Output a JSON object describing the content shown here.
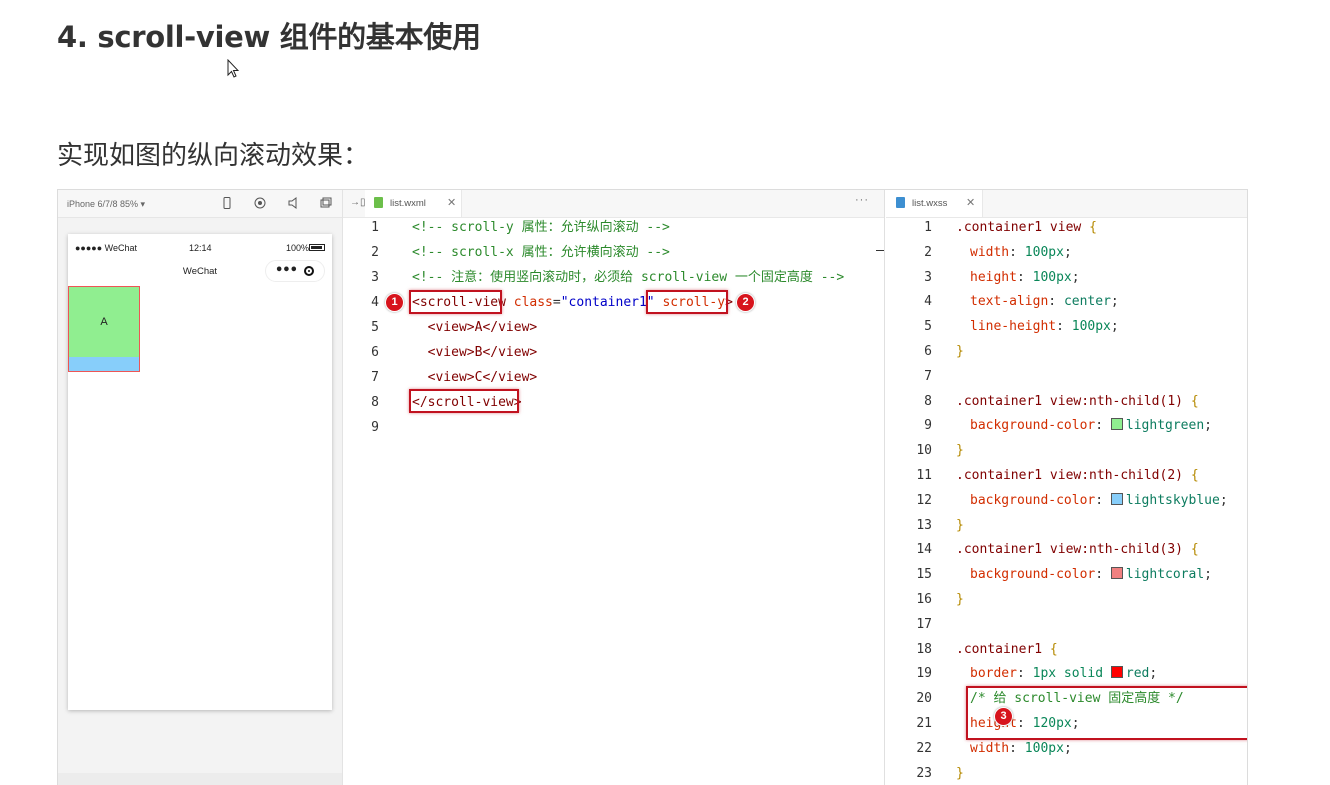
{
  "heading": "4. scroll-view 组件的基本使用",
  "subheading": "实现如图的纵向滚动效果：",
  "simulator": {
    "device": "iPhone 6/7/8 85% ▾",
    "status_left": "●●●●● WeChat",
    "time": "12:14",
    "battery": "100%",
    "nav_title": "WeChat",
    "box_a_label": "A"
  },
  "editor1": {
    "tab_label": "list.wxml",
    "lines": [
      {
        "n": "1",
        "text": "<!-- scroll-y 属性：允许纵向滚动 -->"
      },
      {
        "n": "2",
        "text": "<!-- scroll-x 属性：允许横向滚动 -->"
      },
      {
        "n": "3",
        "text": "<!-- 注意：使用竖向滚动时，必须给 scroll-view 一个固定高度 -->"
      },
      {
        "n": "4",
        "tag_open": "<scroll-view",
        "attr": " class",
        "eq": "=",
        "str": "\"container1\"",
        "attr2": " scroll-y",
        "close": ">"
      },
      {
        "n": "5",
        "text": "  <view>A</view>"
      },
      {
        "n": "6",
        "text": "  <view>B</view>"
      },
      {
        "n": "7",
        "text": "  <view>C</view>"
      },
      {
        "n": "8",
        "text": "</scroll-view>"
      },
      {
        "n": "9",
        "text": ""
      }
    ],
    "badges": [
      "1",
      "2"
    ]
  },
  "editor2": {
    "tab_label": "list.wxss",
    "lines": [
      {
        "n": "1",
        "sel": ".container1 view ",
        "brace": "{"
      },
      {
        "n": "2",
        "prop": "width",
        "val": "100px"
      },
      {
        "n": "3",
        "prop": "height",
        "val": "100px"
      },
      {
        "n": "4",
        "prop": "text-align",
        "val": "center"
      },
      {
        "n": "5",
        "prop": "line-height",
        "val": "100px"
      },
      {
        "n": "6",
        "brace": "}"
      },
      {
        "n": "7"
      },
      {
        "n": "8",
        "sel": ".container1 view:nth-child(1) ",
        "brace": "{"
      },
      {
        "n": "9",
        "prop": "background-color",
        "val": "lightgreen",
        "swatch": "#90ee90"
      },
      {
        "n": "10",
        "brace": "}"
      },
      {
        "n": "11",
        "sel": ".container1 view:nth-child(2) ",
        "brace": "{"
      },
      {
        "n": "12",
        "prop": "background-color",
        "val": "lightskyblue",
        "swatch": "#87cefa"
      },
      {
        "n": "13",
        "brace": "}"
      },
      {
        "n": "14",
        "sel": ".container1 view:nth-child(3) ",
        "brace": "{"
      },
      {
        "n": "15",
        "prop": "background-color",
        "val": "lightcoral",
        "swatch": "#f08080"
      },
      {
        "n": "16",
        "brace": "}"
      },
      {
        "n": "17"
      },
      {
        "n": "18",
        "sel": ".container1 ",
        "brace": "{"
      },
      {
        "n": "19",
        "prop": "border",
        "val": "1px solid ",
        "val2": "red",
        "swatch": "#ff0000"
      },
      {
        "n": "20",
        "comment": "/* 给 scroll-view 固定高度 */"
      },
      {
        "n": "21",
        "prop": "height",
        "val": "120px"
      },
      {
        "n": "22",
        "prop": "width",
        "val": "100px"
      },
      {
        "n": "23",
        "brace": "}"
      }
    ],
    "badge": "3"
  },
  "colors": {
    "highlight": "#c1121f",
    "comment": "#2c8a2c",
    "tag": "#800000",
    "attribute": "#d22d00",
    "string": "#0000c8"
  }
}
